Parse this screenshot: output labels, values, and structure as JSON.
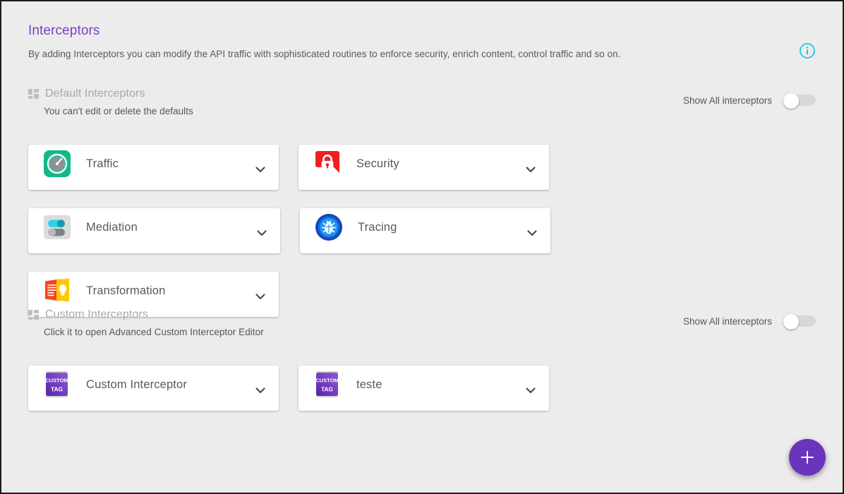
{
  "header": {
    "title": "Interceptors",
    "description": "By adding Interceptors you can modify the API traffic with sophisticated routines to enforce security, enrich content, control traffic and so on.",
    "info_icon": "info-circle-icon",
    "title_color": "#7a3fc0",
    "info_icon_color": "#18c3e0"
  },
  "default_section": {
    "title": "Default Interceptors",
    "subtitle": "You can't edit or delete the defaults",
    "section_icon": "dashboard-grid-icon",
    "toggle": {
      "label": "Show All interceptors",
      "state": "off"
    },
    "cards": [
      {
        "label": "Traffic",
        "icon": "gauge-icon",
        "chevron": "chevron-down-icon"
      },
      {
        "label": "Security",
        "icon": "padlock-icon",
        "chevron": "chevron-down-icon"
      },
      {
        "label": "Mediation",
        "icon": "toggles-icon",
        "chevron": "chevron-down-icon"
      },
      {
        "label": "Tracing",
        "icon": "bug-icon",
        "chevron": "chevron-down-icon"
      },
      {
        "label": "Transformation",
        "icon": "document-bulb-icon",
        "chevron": "chevron-down-icon"
      }
    ]
  },
  "custom_section": {
    "title": "Custom Interceptors",
    "subtitle": "Click it to open Advanced Custom Interceptor Editor",
    "section_icon": "dashboard-grid-icon",
    "toggle": {
      "label": "Show All interceptors",
      "state": "off"
    },
    "cards": [
      {
        "label": "Custom Interceptor",
        "icon": "custom-tag-icon",
        "icon_line1": "CUSTOM",
        "icon_line2": "TAG",
        "chevron": "chevron-down-icon"
      },
      {
        "label": "teste",
        "icon": "custom-tag-icon",
        "icon_line1": "CUSTOM",
        "icon_line2": "TAG",
        "chevron": "chevron-down-icon"
      }
    ]
  },
  "fab": {
    "label": "+",
    "name": "add-interceptor-button",
    "color": "#6a34bd"
  },
  "colors": {
    "background": "#ececed",
    "card_background": "#ffffff",
    "accent_purple": "#6a34bd",
    "accent_cyan": "#18c3e0",
    "traffic_green": "#12b887",
    "security_red": "#ef2020",
    "tracing_blue": "#1565d8",
    "transformation_orange": "#f4441e",
    "transformation_yellow": "#ffc800"
  }
}
